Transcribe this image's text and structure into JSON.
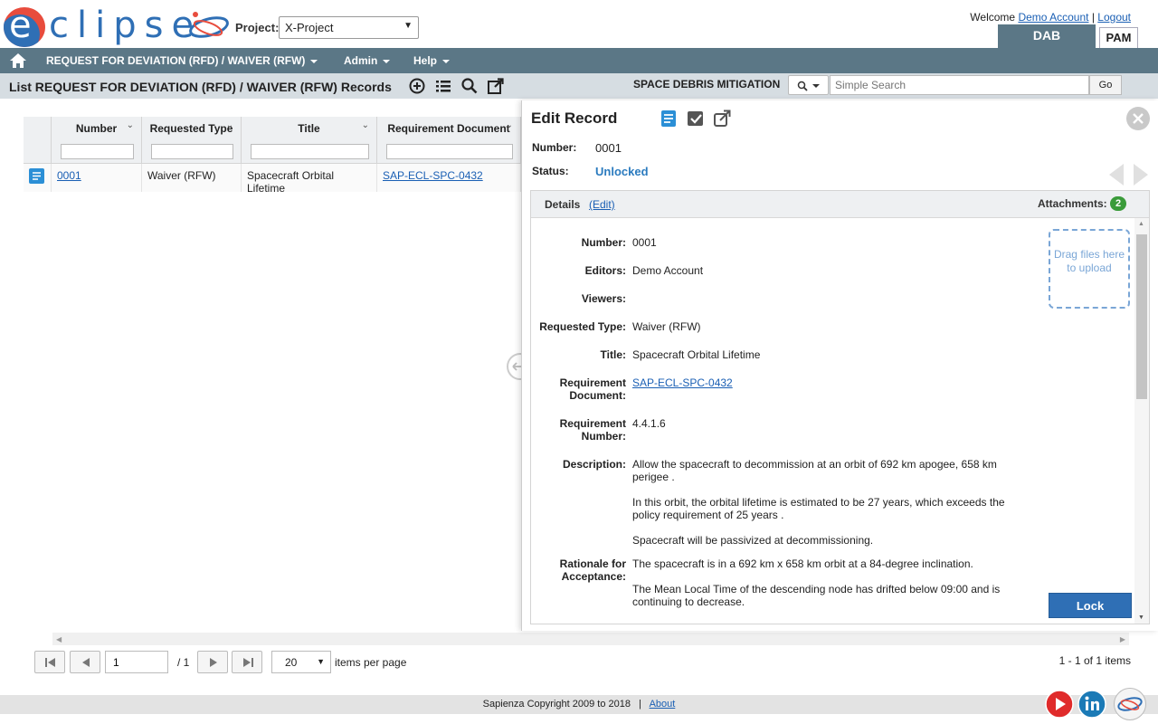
{
  "brand": {
    "logo_text": "clipse",
    "logo_letter": "e"
  },
  "header": {
    "project_label": "Project:",
    "project_value": "X-Project",
    "welcome_text": "Welcome",
    "user_link": "Demo Account",
    "separator": "|",
    "logout_link": "Logout",
    "tabs": [
      {
        "label": "DAB"
      },
      {
        "label": "PAM"
      }
    ]
  },
  "nav": {
    "items": [
      {
        "label": "REQUEST FOR DEVIATION (RFD) / WAIVER (RFW)"
      },
      {
        "label": "Admin"
      },
      {
        "label": "Help"
      }
    ]
  },
  "toolbar": {
    "title": "List REQUEST FOR DEVIATION (RFD) / WAIVER (RFW) Records",
    "context_label": "SPACE DEBRIS MITIGATION",
    "search_placeholder": "Simple Search",
    "go_label": "Go"
  },
  "grid": {
    "columns": [
      "Number",
      "Requested Type",
      "Title",
      "Requirement Document"
    ],
    "rows": [
      {
        "number": "0001",
        "requested_type": "Waiver (RFW)",
        "title": "Spacecraft Orbital Lifetime",
        "requirement_document": "SAP-ECL-SPC-0432"
      }
    ]
  },
  "pagination": {
    "page": "1",
    "of_label": "/ 1",
    "per_page": "20",
    "per_page_label": "items per page",
    "summary": "1 - 1 of 1 items"
  },
  "footer": {
    "copyright": "Sapienza Copyright 2009 to 2018",
    "separator": "|",
    "about_link": "About"
  },
  "panel": {
    "title": "Edit Record",
    "number_label": "Number:",
    "number_value": "0001",
    "status_label": "Status:",
    "status_value": "Unlocked",
    "details_tab": "Details",
    "edit_link": "(Edit)",
    "attachments_label": "Attachments:",
    "attachments_count": "2",
    "dropzone_text": "Drag files here to upload",
    "lock_label": "Lock",
    "fields": [
      {
        "label": "Number:",
        "value": "0001"
      },
      {
        "label": "Editors:",
        "value": "Demo Account"
      },
      {
        "label": "Viewers:",
        "value": ""
      },
      {
        "label": "Requested Type:",
        "value": "Waiver (RFW)"
      },
      {
        "label": "Title:",
        "value": "Spacecraft Orbital Lifetime"
      },
      {
        "label": "Requirement Document:",
        "value": "SAP-ECL-SPC-0432"
      },
      {
        "label": "Requirement Number:",
        "value": "4.4.1.6"
      },
      {
        "label": "Description:",
        "value": "Allow the spacecraft to decommission at an orbit of 692 km apogee, 658 km perigee ."
      },
      {
        "label": "",
        "value": "In this orbit, the orbital lifetime is estimated to be 27 years, which exceeds the policy requirement of 25 years ."
      },
      {
        "label": "",
        "value": "Spacecraft will be passivized at decommissioning."
      },
      {
        "label": "Rationale for Acceptance:",
        "value": "The spacecraft is in a 692 km x 658 km orbit at a 84-degree inclination."
      },
      {
        "label": "",
        "value": "The Mean Local Time of the descending node has drifted below 09:00 and is continuing to decrease."
      }
    ]
  }
}
